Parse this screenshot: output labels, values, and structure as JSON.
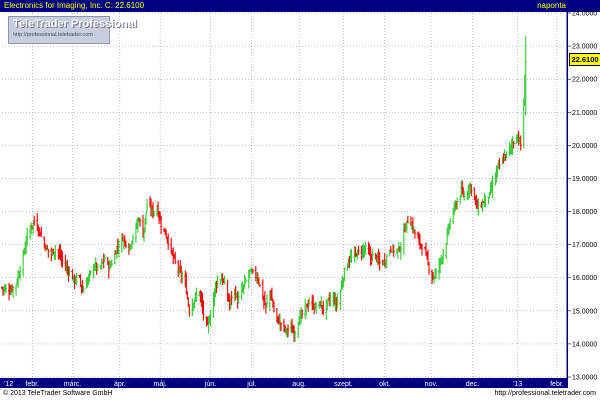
{
  "header": {
    "title": "Electronics for Imaging, Inc.  C: 22.6100",
    "period": "naponta"
  },
  "logo": {
    "name": "TeleTrader Professional",
    "url": "http://professional.teletrader.com"
  },
  "footer": {
    "copyright": "© 2013 TeleTrader Software GmbH",
    "url": "http://professional.teletrader.com"
  },
  "last_price_badge": "22.6100",
  "colors": {
    "up": "#33cc33",
    "down": "#ff0000",
    "axis_bar": "#000080",
    "grid": "#8080a0"
  },
  "chart_data": {
    "type": "bar",
    "title": "Electronics for Imaging, Inc.  C: 22.6100",
    "xlabel": "",
    "ylabel": "",
    "ylim": [
      13.0,
      24.0
    ],
    "yticks": [
      "13.0000",
      "14.0000",
      "15.0000",
      "16.0000",
      "17.0000",
      "18.0000",
      "19.0000",
      "20.0000",
      "21.0000",
      "22.0000",
      "23.0000",
      "24.0000"
    ],
    "xticks": [
      {
        "label": "'12",
        "day": 0
      },
      {
        "label": "febr.",
        "day": 30
      },
      {
        "label": "márc.",
        "day": 70
      },
      {
        "label": "ápr.",
        "day": 117
      },
      {
        "label": "máj.",
        "day": 157
      },
      {
        "label": "jún.",
        "day": 207
      },
      {
        "label": "júl.",
        "day": 248
      },
      {
        "label": "aug.",
        "day": 295
      },
      {
        "label": "szept.",
        "day": 339
      },
      {
        "label": "okt.",
        "day": 380
      },
      {
        "label": "nov.",
        "day": 426
      },
      {
        "label": "dec.",
        "day": 467
      },
      {
        "label": "'13",
        "day": 512
      },
      {
        "label": "febr.",
        "day": 551
      }
    ],
    "grid": true,
    "series": [
      {
        "close_path": [
          [
            0,
            15.7
          ],
          [
            8,
            15.6
          ],
          [
            14,
            15.8
          ],
          [
            20,
            16.5
          ],
          [
            26,
            17.4
          ],
          [
            32,
            17.7
          ],
          [
            36,
            17.5
          ],
          [
            42,
            17.0
          ],
          [
            48,
            16.7
          ],
          [
            54,
            16.9
          ],
          [
            60,
            16.5
          ],
          [
            66,
            16.2
          ],
          [
            72,
            15.9
          ],
          [
            76,
            16.1
          ],
          [
            80,
            15.6
          ],
          [
            86,
            16.0
          ],
          [
            92,
            16.4
          ],
          [
            96,
            16.2
          ],
          [
            102,
            16.6
          ],
          [
            106,
            16.3
          ],
          [
            110,
            16.5
          ],
          [
            114,
            16.9
          ],
          [
            120,
            17.2
          ],
          [
            126,
            16.9
          ],
          [
            132,
            17.4
          ],
          [
            136,
            17.8
          ],
          [
            140,
            17.3
          ],
          [
            144,
            18.2
          ],
          [
            150,
            18.0
          ],
          [
            154,
            18.1
          ],
          [
            158,
            17.6
          ],
          [
            164,
            17.2
          ],
          [
            170,
            16.6
          ],
          [
            176,
            16.2
          ],
          [
            182,
            15.8
          ],
          [
            186,
            15.0
          ],
          [
            190,
            15.3
          ],
          [
            196,
            15.6
          ],
          [
            200,
            14.9
          ],
          [
            204,
            14.5
          ],
          [
            208,
            15.0
          ],
          [
            212,
            15.8
          ],
          [
            218,
            16.0
          ],
          [
            222,
            15.7
          ],
          [
            226,
            15.2
          ],
          [
            230,
            15.7
          ],
          [
            234,
            15.3
          ],
          [
            238,
            15.6
          ],
          [
            242,
            15.9
          ],
          [
            246,
            16.2
          ],
          [
            250,
            16.1
          ],
          [
            254,
            16.0
          ],
          [
            258,
            15.5
          ],
          [
            262,
            15.1
          ],
          [
            266,
            15.6
          ],
          [
            270,
            15.0
          ],
          [
            274,
            14.7
          ],
          [
            278,
            14.6
          ],
          [
            282,
            14.4
          ],
          [
            286,
            14.5
          ],
          [
            290,
            14.3
          ],
          [
            294,
            14.7
          ],
          [
            298,
            14.9
          ],
          [
            302,
            15.1
          ],
          [
            306,
            15.3
          ],
          [
            310,
            15.1
          ],
          [
            316,
            15.2
          ],
          [
            320,
            15.0
          ],
          [
            324,
            15.3
          ],
          [
            328,
            15.4
          ],
          [
            332,
            15.2
          ],
          [
            336,
            15.6
          ],
          [
            340,
            16.2
          ],
          [
            344,
            16.5
          ],
          [
            350,
            16.7
          ],
          [
            356,
            16.8
          ],
          [
            362,
            16.9
          ],
          [
            366,
            16.6
          ],
          [
            370,
            16.7
          ],
          [
            376,
            16.4
          ],
          [
            380,
            16.5
          ],
          [
            386,
            16.9
          ],
          [
            390,
            16.8
          ],
          [
            396,
            16.9
          ],
          [
            400,
            17.5
          ],
          [
            404,
            17.8
          ],
          [
            408,
            17.5
          ],
          [
            412,
            17.2
          ],
          [
            416,
            17.0
          ],
          [
            420,
            16.8
          ],
          [
            424,
            16.3
          ],
          [
            428,
            16.0
          ],
          [
            432,
            16.2
          ],
          [
            436,
            16.6
          ],
          [
            440,
            16.9
          ],
          [
            444,
            17.6
          ],
          [
            448,
            18.0
          ],
          [
            452,
            18.3
          ],
          [
            456,
            18.6
          ],
          [
            460,
            18.4
          ],
          [
            464,
            18.8
          ],
          [
            468,
            18.6
          ],
          [
            472,
            18.1
          ],
          [
            476,
            18.2
          ],
          [
            480,
            18.4
          ],
          [
            484,
            18.5
          ],
          [
            488,
            18.9
          ],
          [
            492,
            19.3
          ],
          [
            496,
            19.5
          ],
          [
            500,
            19.7
          ],
          [
            504,
            19.9
          ],
          [
            508,
            20.1
          ],
          [
            512,
            20.3
          ],
          [
            516,
            19.9
          ],
          [
            520,
            22.6
          ]
        ]
      }
    ],
    "last_close": 22.61
  }
}
